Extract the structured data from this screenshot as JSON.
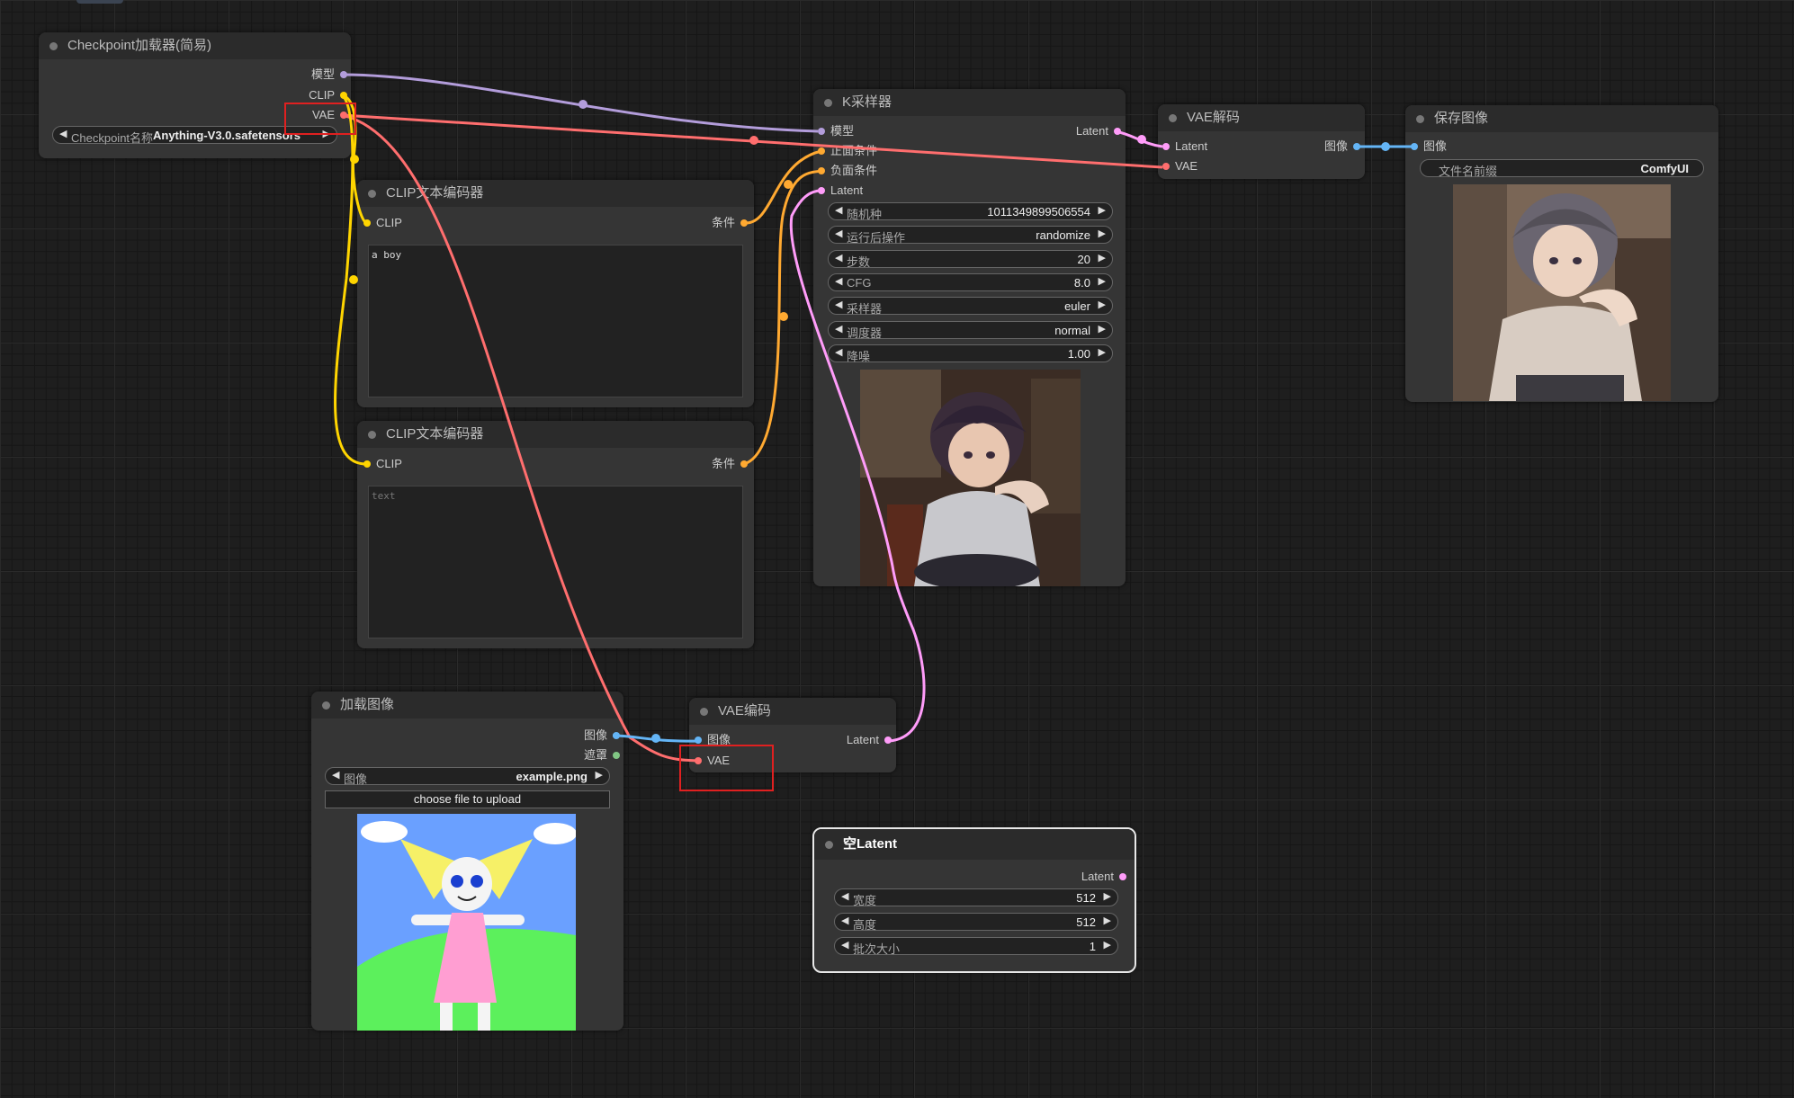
{
  "colors": {
    "model": "#b39ddb",
    "clip": "#ffd500",
    "vae": "#ff6e6e",
    "conditioning": "#ffa931",
    "latent": "#ff9cf9",
    "image": "#64b5f6",
    "mask": "#81c784"
  },
  "nodes": {
    "checkpoint": {
      "title": "Checkpoint加载器(简易)",
      "outputs": [
        "模型",
        "CLIP",
        "VAE"
      ],
      "widget": {
        "label": "Checkpoint名称",
        "value": "Anything-V3.0.safetensors"
      }
    },
    "clip_text_1": {
      "title": "CLIP文本编码器",
      "input": "CLIP",
      "output": "条件",
      "text": "a boy"
    },
    "clip_text_2": {
      "title": "CLIP文本编码器",
      "input": "CLIP",
      "output": "条件",
      "placeholder": "text"
    },
    "ksampler": {
      "title": "K采样器",
      "inputs": [
        "模型",
        "正面条件",
        "负面条件",
        "Latent"
      ],
      "output": "Latent",
      "widgets": [
        {
          "label": "随机种",
          "value": "1011349899506554"
        },
        {
          "label": "运行后操作",
          "value": "randomize"
        },
        {
          "label": "步数",
          "value": "20"
        },
        {
          "label": "CFG",
          "value": "8.0"
        },
        {
          "label": "采样器",
          "value": "euler"
        },
        {
          "label": "调度器",
          "value": "normal"
        },
        {
          "label": "降噪",
          "value": "1.00"
        }
      ]
    },
    "vae_decode": {
      "title": "VAE解码",
      "inputs": [
        "Latent",
        "VAE"
      ],
      "output": "图像"
    },
    "save_image": {
      "title": "保存图像",
      "input": "图像",
      "widget": {
        "label": "文件名前缀",
        "value": "ComfyUI"
      }
    },
    "load_image": {
      "title": "加载图像",
      "outputs": [
        "图像",
        "遮罩"
      ],
      "widget": {
        "label": "图像",
        "value": "example.png"
      },
      "upload_label": "choose file to upload"
    },
    "vae_encode": {
      "title": "VAE编码",
      "inputs": [
        "图像",
        "VAE"
      ],
      "output": "Latent"
    },
    "empty_latent": {
      "title": "空Latent",
      "output": "Latent",
      "widgets": [
        {
          "label": "宽度",
          "value": "512"
        },
        {
          "label": "高度",
          "value": "512"
        },
        {
          "label": "批次大小",
          "value": "1"
        }
      ]
    }
  }
}
